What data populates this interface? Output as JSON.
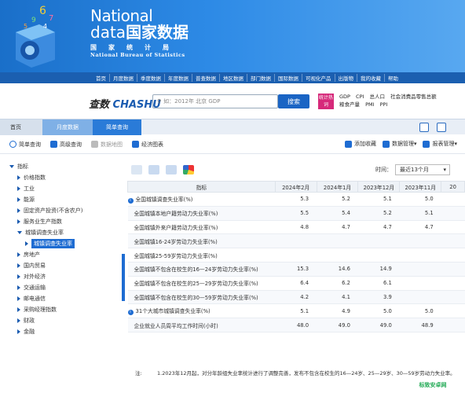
{
  "header": {
    "brand_line1": "National",
    "brand_line2a": "data",
    "brand_line2b": "国家数据",
    "brand_line3": "国家统计局",
    "brand_line4": "National Bureau of Statistics"
  },
  "nav": [
    "首页",
    "月度数据",
    "季度数据",
    "年度数据",
    "普查数据",
    "地区数据",
    "部门数据",
    "国际数据",
    "可视化产品",
    "出版物",
    "我的收藏",
    "帮助"
  ],
  "search": {
    "logo_a": "查数",
    "logo_b": "CHASHU",
    "placeholder": "如：2012年 北京 GDP",
    "button": "搜索",
    "hot_badge": "统计热词",
    "hot_row1": [
      "GDP",
      "CPI",
      "总人口",
      "社会消费品零售总额"
    ],
    "hot_row2": [
      "粮食产量",
      "PMI",
      "PPI"
    ]
  },
  "breadcrumb": [
    "首页",
    "月度数据",
    "简单查询"
  ],
  "toolbar": {
    "left": [
      "简单查询",
      "高级查询",
      "数据地图",
      "经济图表"
    ],
    "right": [
      "添加收藏",
      "数据管理",
      "报表管理"
    ]
  },
  "sidebar": {
    "root": "指标",
    "items": [
      "价格指数",
      "工业",
      "能源",
      "固定资产投资(不含农户)",
      "服务业生产指数",
      "城镇调查失业率",
      "城镇调查失业率",
      "房地产",
      "国内贸易",
      "对外经济",
      "交通运输",
      "邮电通信",
      "采购经理指数",
      "财政",
      "金融"
    ]
  },
  "time": {
    "label": "时间：",
    "value": "最近13个月"
  },
  "table": {
    "headers": [
      "指标",
      "2024年2月",
      "2024年1月",
      "2023年12月",
      "2023年11月",
      "20"
    ],
    "rows": [
      {
        "name": "全国城镇调查失业率(%)",
        "vals": [
          "5.3",
          "5.2",
          "5.1",
          "5.0"
        ]
      },
      {
        "name": "全国城镇本地户籍劳动力失业率(%)",
        "vals": [
          "5.5",
          "5.4",
          "5.2",
          "5.1"
        ]
      },
      {
        "name": "全国城镇外来户籍劳动力失业率(%)",
        "vals": [
          "4.8",
          "4.7",
          "4.7",
          "4.7"
        ]
      },
      {
        "name": "全国城镇16-24岁劳动力失业率(%)",
        "vals": [
          "",
          "",
          "",
          ""
        ]
      },
      {
        "name": "全国城镇25-59岁劳动力失业率(%)",
        "vals": [
          "",
          "",
          "",
          ""
        ]
      },
      {
        "name": "全国城镇不包含在校生的16—24岁劳动力失业率(%)",
        "vals": [
          "15.3",
          "14.6",
          "14.9",
          ""
        ]
      },
      {
        "name": "全国城镇不包含在校生的25—29岁劳动力失业率(%)",
        "vals": [
          "6.4",
          "6.2",
          "6.1",
          ""
        ]
      },
      {
        "name": "全国城镇不包含在校生的30—59岁劳动力失业率(%)",
        "vals": [
          "4.2",
          "4.1",
          "3.9",
          ""
        ]
      },
      {
        "name": "31个大城市城镇调查失业率(%)",
        "vals": [
          "5.1",
          "4.9",
          "5.0",
          "5.0"
        ]
      },
      {
        "name": "企业就业人员周平均工作时间(小时)",
        "vals": [
          "48.0",
          "49.0",
          "49.0",
          "48.9"
        ]
      }
    ]
  },
  "notes": {
    "label": "注:",
    "text": "1.2023年12月起，对分年龄组失业率统计进行了调整完善，发布不包含在校生的16—24岁、25—29岁、30—59岁劳动力失业率。"
  },
  "watermark": "标致安卓网",
  "colors": {
    "banner": "#1a6fc9",
    "nav": "#1b5fb0",
    "accent": "#1e6cd2",
    "hot": "#d6297a"
  }
}
